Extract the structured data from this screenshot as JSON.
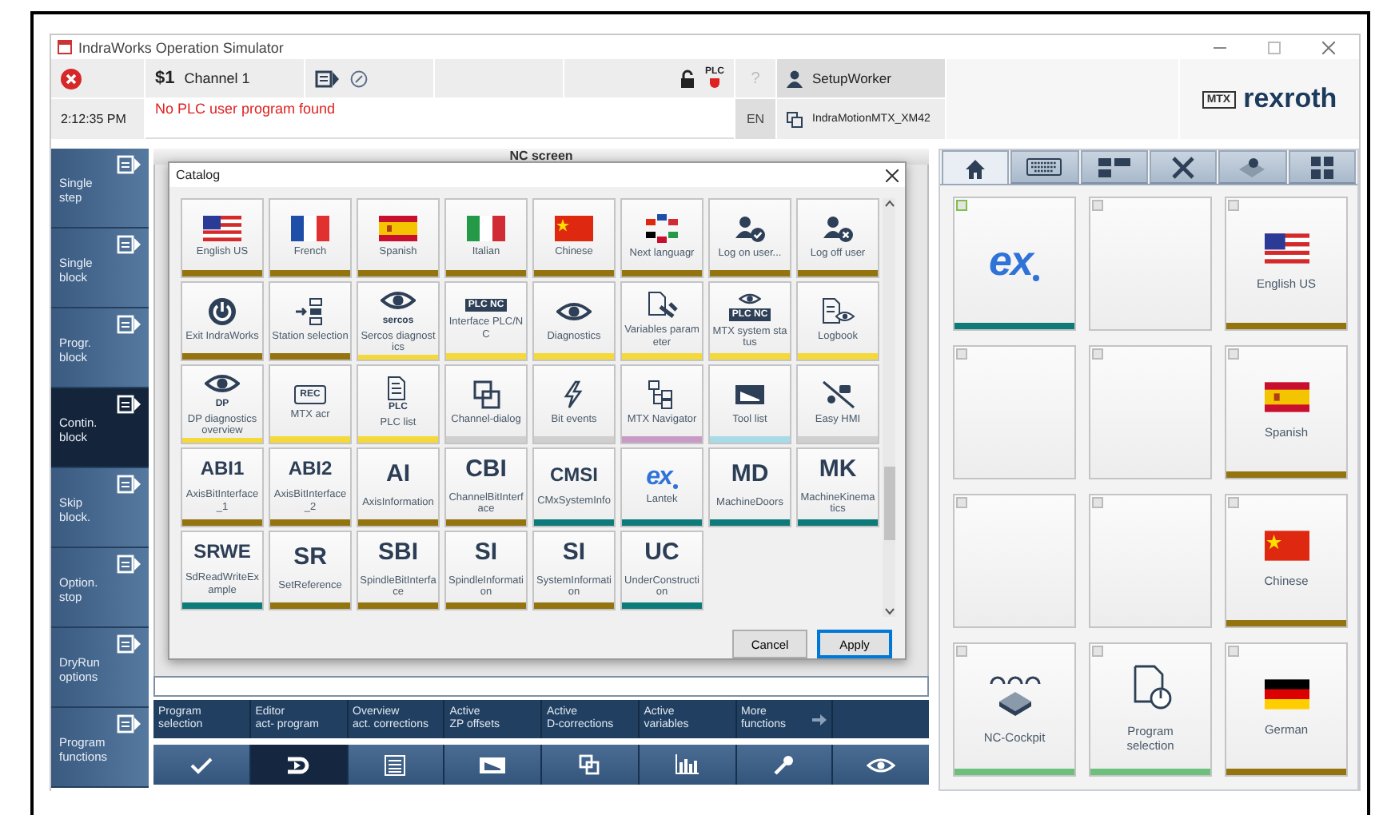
{
  "window": {
    "title": "IndraWorks Operation Simulator"
  },
  "header": {
    "time": "2:12:35 PM",
    "channel_number": "$1",
    "channel_name": "Channel 1",
    "message": "No PLC user program found",
    "plc_badge": "PLC",
    "help": "?",
    "language": "EN",
    "user": "SetupWorker",
    "device": "IndraMotionMTX_XM42",
    "logo_badge": "MTX",
    "logo": "rexroth"
  },
  "sidebar": {
    "items": [
      {
        "label": "Single\nstep",
        "selected": false
      },
      {
        "label": "Single\nblock",
        "selected": false
      },
      {
        "label": "Progr.\nblock",
        "selected": false
      },
      {
        "label": "Contin.\nblock",
        "selected": true
      },
      {
        "label": "Skip\nblock.",
        "selected": false
      },
      {
        "label": "Option.\nstop",
        "selected": false
      },
      {
        "label": "DryRun\noptions",
        "selected": false
      },
      {
        "label": "Program\nfunctions",
        "selected": false
      }
    ]
  },
  "nc_screen": {
    "title": "NC screen"
  },
  "function_bar": {
    "items": [
      "Program\nselection",
      "Editor\nact- program",
      "Overview\nact. corrections",
      "Active\nZP offsets",
      "Active\nD-corrections",
      "Active\nvariables",
      "More\nfunctions"
    ]
  },
  "bottom_tabs": [
    {
      "selected": false
    },
    {
      "selected": true
    },
    {
      "selected": false
    },
    {
      "selected": false
    },
    {
      "selected": false
    },
    {
      "selected": false
    },
    {
      "selected": false
    },
    {
      "selected": false
    }
  ],
  "catalog": {
    "title": "Catalog",
    "tiles": [
      {
        "kind": "icon",
        "label": "English US",
        "color": "#94740e"
      },
      {
        "kind": "icon",
        "label": "French",
        "color": "#94740e"
      },
      {
        "kind": "icon",
        "label": "Spanish",
        "color": "#94740e"
      },
      {
        "kind": "icon",
        "label": "Italian",
        "color": "#94740e"
      },
      {
        "kind": "icon",
        "label": "Chinese",
        "color": "#94740e"
      },
      {
        "kind": "icon",
        "label": "Next languagr",
        "color": "#94740e"
      },
      {
        "kind": "icon",
        "label": "Log on user...",
        "color": "#94740e"
      },
      {
        "kind": "icon",
        "label": "Log off user",
        "color": "#94740e"
      },
      {
        "kind": "icon",
        "label": "Exit IndraWorks",
        "color": "#94740e"
      },
      {
        "kind": "icon",
        "label": "Station selection",
        "color": "#94740e"
      },
      {
        "kind": "icon",
        "label": "Sercos diagnostics",
        "icon_text": "sercos",
        "color": "#f5d93a"
      },
      {
        "kind": "icon",
        "label": "Interface PLC/NC",
        "icon_text": "PLC NC",
        "color": "#f5d93a"
      },
      {
        "kind": "icon",
        "label": "Diagnostics",
        "color": "#f5d93a"
      },
      {
        "kind": "icon",
        "label": "Variables parameter",
        "color": "#f5d93a"
      },
      {
        "kind": "icon",
        "label": "MTX system status",
        "icon_text": "PLC NC",
        "color": "#f5d93a"
      },
      {
        "kind": "icon",
        "label": "Logbook",
        "color": "#f5d93a"
      },
      {
        "kind": "icon",
        "label": "DP diagnostics overview",
        "icon_text": "DP",
        "color": "#f5d93a"
      },
      {
        "kind": "icon",
        "label": "MTX acr",
        "icon_text": "REC",
        "color": "#f5d93a"
      },
      {
        "kind": "icon",
        "label": "PLC list",
        "icon_text": "PLC",
        "color": "#f5d93a"
      },
      {
        "kind": "icon",
        "label": "Channel-dialog",
        "color": "#cfcfcf"
      },
      {
        "kind": "icon",
        "label": "Bit events",
        "color": "#cfcfcf"
      },
      {
        "kind": "icon",
        "label": "MTX Navigator",
        "color": "#c99ac6"
      },
      {
        "kind": "icon",
        "label": "Tool list",
        "color": "#a8dbe8"
      },
      {
        "kind": "icon",
        "label": "Easy HMI",
        "color": "#cfcfcf"
      },
      {
        "kind": "abbreviation",
        "abbreviation": "ABI1",
        "label": "AxisBitInterface_1",
        "color": "#94740e"
      },
      {
        "kind": "abbreviation",
        "abbreviation": "ABI2",
        "label": "AxisBitInterface_2",
        "color": "#94740e"
      },
      {
        "kind": "abbreviation",
        "abbreviation": "AI",
        "label": "AxisInformation",
        "color": "#94740e"
      },
      {
        "kind": "abbreviation",
        "abbreviation": "CBI",
        "label": "ChannelBitInterface",
        "color": "#94740e"
      },
      {
        "kind": "abbreviation",
        "abbreviation": "CMSI",
        "label": "CMxSystemInfo",
        "color": "#0e7b7b"
      },
      {
        "kind": "logo",
        "logo": "ex",
        "label": "Lantek",
        "color": "#0e7b7b"
      },
      {
        "kind": "abbreviation",
        "abbreviation": "MD",
        "label": "MachineDoors",
        "color": "#0e7b7b"
      },
      {
        "kind": "abbreviation",
        "abbreviation": "MK",
        "label": "MachineKinematics",
        "color": "#0e7b7b"
      },
      {
        "kind": "abbreviation",
        "abbreviation": "SRWE",
        "label": "SdReadWriteExample",
        "color": "#0e7b7b"
      },
      {
        "kind": "abbreviation",
        "abbreviation": "SR",
        "label": "SetReference",
        "color": "#94740e"
      },
      {
        "kind": "abbreviation",
        "abbreviation": "SBI",
        "label": "SpindleBitInterface",
        "color": "#94740e"
      },
      {
        "kind": "abbreviation",
        "abbreviation": "SI",
        "label": "SpindleInformation",
        "color": "#94740e"
      },
      {
        "kind": "abbreviation",
        "abbreviation": "SI",
        "label": "SystemInformation",
        "color": "#94740e"
      },
      {
        "kind": "abbreviation",
        "abbreviation": "UC",
        "label": "UnderConstruction",
        "color": "#0e7b7b"
      }
    ],
    "buttons": [
      {
        "label": "Cancel",
        "default": false
      },
      {
        "label": "Apply",
        "default": true
      }
    ]
  },
  "panel": {
    "tabs": [
      {
        "selected": true
      },
      {
        "selected": false
      },
      {
        "selected": false
      },
      {
        "selected": false
      },
      {
        "selected": false
      },
      {
        "selected": false
      }
    ],
    "tiles": [
      {
        "kind": "logo",
        "logo": "ex",
        "color": "#0e7b7b",
        "selected": true
      },
      {
        "kind": "empty",
        "selected": false
      },
      {
        "kind": "icon",
        "label": "English US",
        "color": "#94740e",
        "selected": false
      },
      {
        "kind": "empty",
        "selected": false
      },
      {
        "kind": "empty",
        "selected": false
      },
      {
        "kind": "icon",
        "label": "Spanish",
        "color": "#94740e",
        "selected": false
      },
      {
        "kind": "empty",
        "selected": false
      },
      {
        "kind": "empty",
        "selected": false
      },
      {
        "kind": "icon",
        "label": "Chinese",
        "color": "#94740e",
        "selected": false
      },
      {
        "kind": "icon",
        "label": "NC-Cockpit",
        "color": "#6cc07c",
        "selected": false
      },
      {
        "kind": "icon",
        "label": "Program\nselection",
        "color": "#6cc07c",
        "selected": false
      },
      {
        "kind": "icon",
        "label": "German",
        "color": "#94740e",
        "selected": false
      }
    ]
  }
}
